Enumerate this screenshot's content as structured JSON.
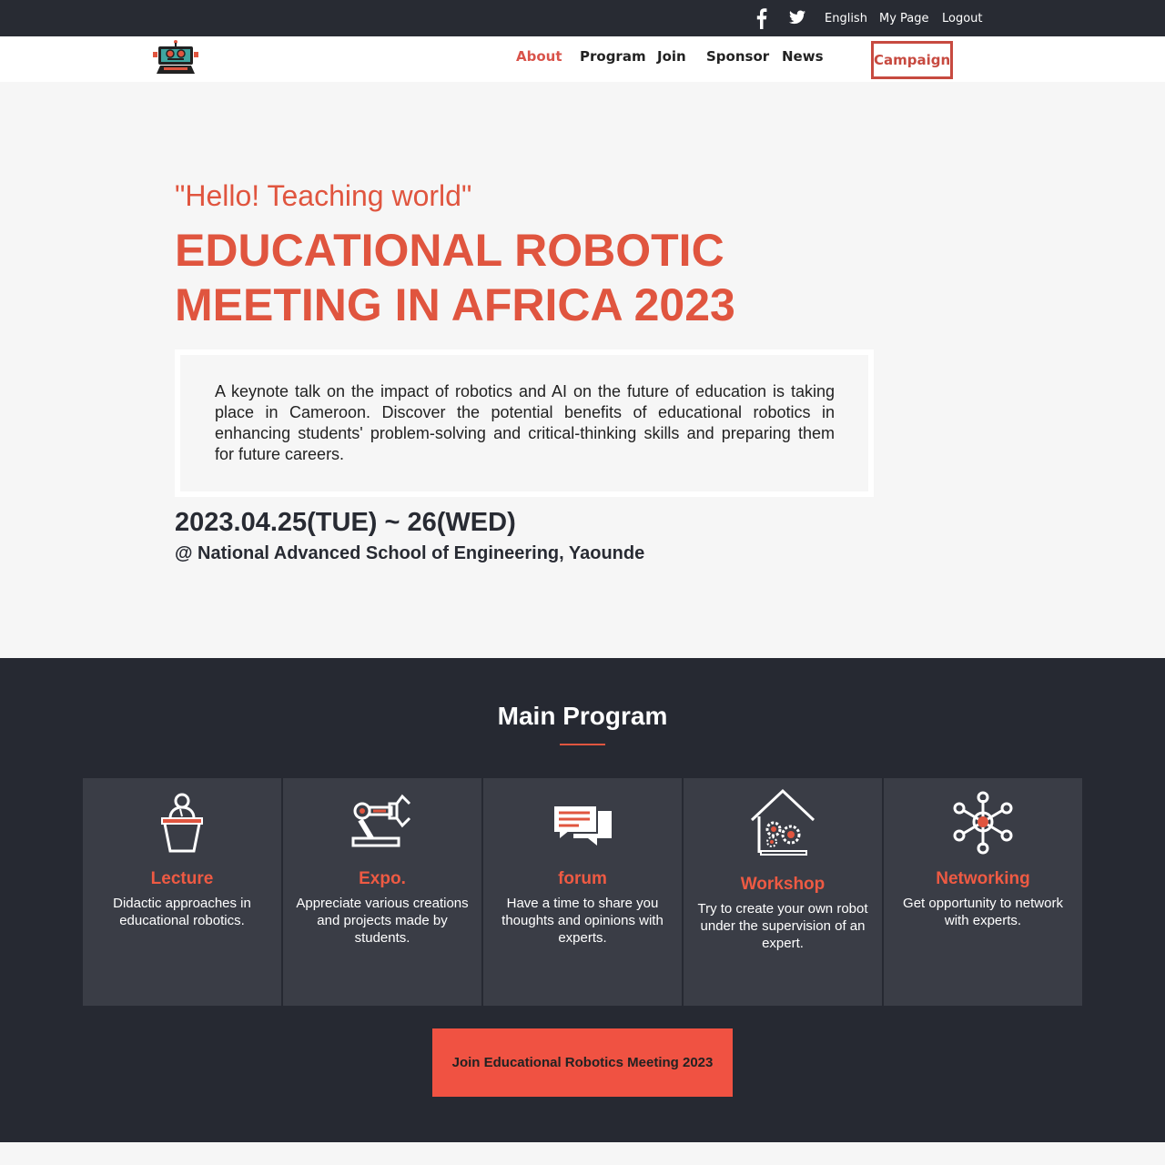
{
  "topbar": {
    "facebook_icon": "facebook-icon",
    "twitter_icon": "twitter-icon",
    "language": "English",
    "my_page": "My Page",
    "logout": "Logout"
  },
  "nav": {
    "logo_icon": "robot-logo",
    "items": [
      {
        "label": "About",
        "active": true
      },
      {
        "label": "Program",
        "active": false
      },
      {
        "label": "Join",
        "active": false
      },
      {
        "label": "Sponsor",
        "active": false
      },
      {
        "label": "News",
        "active": false
      }
    ],
    "campaign": "Campaign"
  },
  "hero": {
    "tagline": "\"Hello! Teaching world\"",
    "title_line1": "EDUCATIONAL ROBOTIC",
    "title_line2": "MEETING IN AFRICA 2023",
    "description": "A keynote talk on the impact of robotics and AI on the future of education is taking place in Cameroon. Discover the potential benefits of educational robotics in enhancing students' problem-solving and critical-thinking skills and preparing them for future careers.",
    "date": "2023.04.25(TUE) ~ 26(WED)",
    "venue": "@ National Advanced School of Engineering, Yaounde"
  },
  "program": {
    "title": "Main Program",
    "cards": [
      {
        "title": "Lecture",
        "text": "Didactic approaches in educational robotics.",
        "icon": "lecture-icon"
      },
      {
        "title": "Expo.",
        "text": "Appreciate various creations and projects made by students.",
        "icon": "robot-arm-icon"
      },
      {
        "title": "forum",
        "text": "Have a time to share you thoughts and opinions with experts.",
        "icon": "chat-icon"
      },
      {
        "title": "Workshop",
        "text": "Try to create your own robot under the supervision of an expert.",
        "icon": "workshop-icon"
      },
      {
        "title": "Networking",
        "text": "Get opportunity to network with experts.",
        "icon": "network-icon"
      }
    ],
    "join_button": "Join Educational Robotics Meeting 2023"
  },
  "colors": {
    "accent": "#e0553f",
    "dark": "#262932",
    "card": "#3a3d46",
    "button": "#f05242"
  }
}
